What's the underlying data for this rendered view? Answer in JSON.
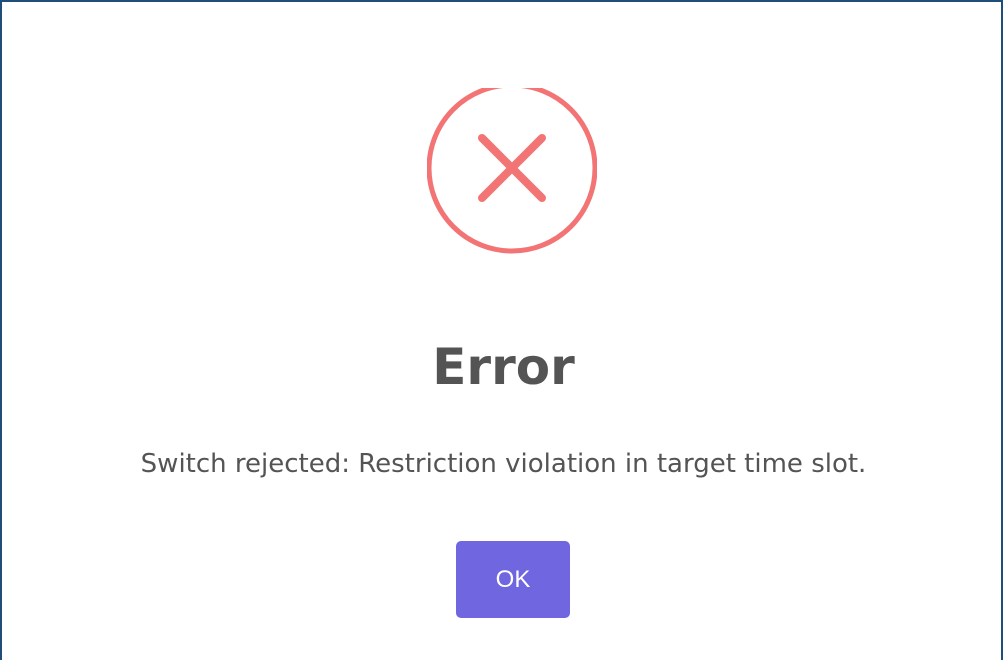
{
  "dialog": {
    "icon": "error-x-icon",
    "icon_color": "#f27474",
    "title": "Error",
    "message": "Switch rejected: Restriction violation in target time slot.",
    "confirm_label": "OK",
    "confirm_color": "#7066e0",
    "border_color": "#1f4e79"
  }
}
